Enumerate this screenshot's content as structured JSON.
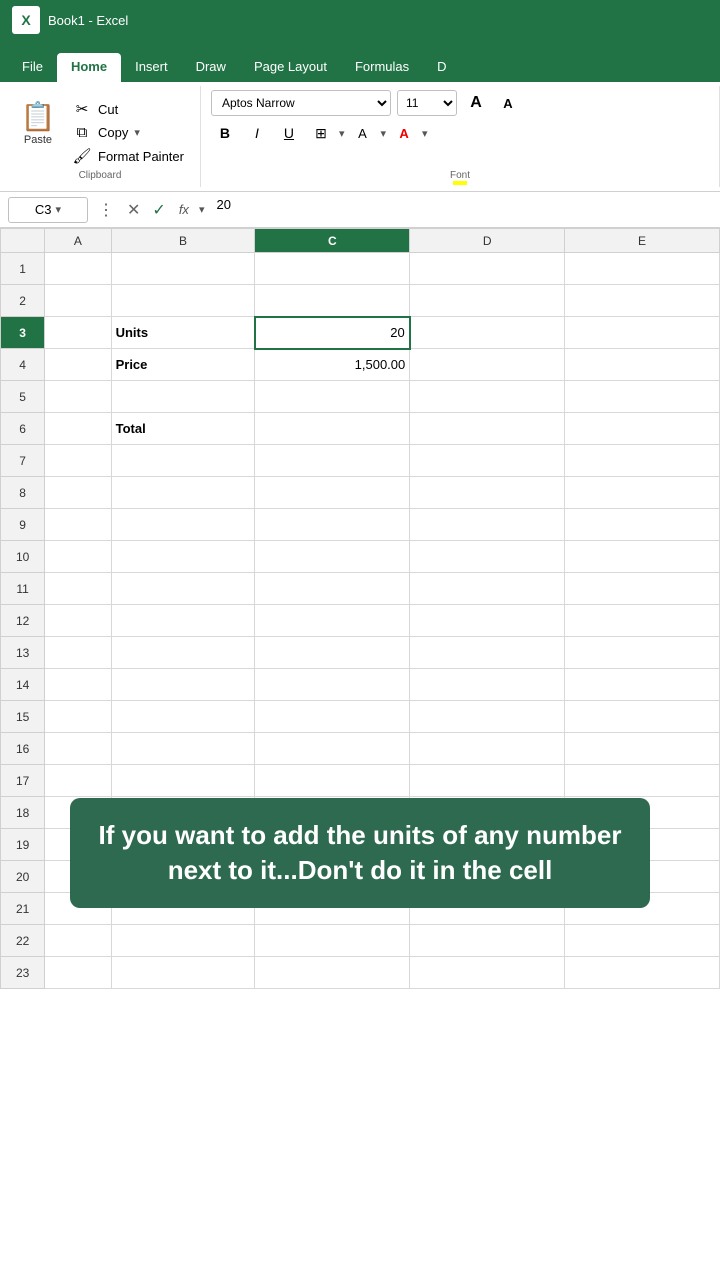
{
  "titlebar": {
    "logo": "X",
    "title": "Book1 - Excel"
  },
  "ribbon": {
    "tabs": [
      "File",
      "Home",
      "Insert",
      "Draw",
      "Page Layout",
      "Formulas",
      "D"
    ],
    "active_tab": "Home",
    "clipboard_group": {
      "label": "Clipboard",
      "paste_label": "Paste",
      "cut_label": "Cut",
      "copy_label": "Copy",
      "format_painter_label": "Format Painter"
    },
    "font_group": {
      "label": "Font",
      "font_name": "Aptos Narrow",
      "font_size": "11",
      "bold": "B",
      "italic": "I",
      "underline": "U"
    }
  },
  "formula_bar": {
    "cell_ref": "C3",
    "formula_value": "20"
  },
  "columns": [
    "A",
    "B",
    "C",
    "D",
    "E"
  ],
  "rows": [
    {
      "num": 1,
      "cells": [
        "",
        "",
        "",
        "",
        ""
      ]
    },
    {
      "num": 2,
      "cells": [
        "",
        "",
        "",
        "",
        ""
      ]
    },
    {
      "num": 3,
      "cells": [
        "",
        "Units",
        "20",
        "",
        ""
      ]
    },
    {
      "num": 4,
      "cells": [
        "",
        "Price",
        "1,500.00",
        "",
        ""
      ]
    },
    {
      "num": 5,
      "cells": [
        "",
        "",
        "",
        "",
        ""
      ]
    },
    {
      "num": 6,
      "cells": [
        "",
        "Total",
        "",
        "",
        ""
      ]
    },
    {
      "num": 7,
      "cells": [
        "",
        "",
        "",
        "",
        ""
      ]
    },
    {
      "num": 8,
      "cells": [
        "",
        "",
        "",
        "",
        ""
      ]
    },
    {
      "num": 9,
      "cells": [
        "",
        "",
        "",
        "",
        ""
      ]
    },
    {
      "num": 10,
      "cells": [
        "",
        "",
        "",
        "",
        ""
      ]
    },
    {
      "num": 11,
      "cells": [
        "",
        "",
        "",
        "",
        ""
      ]
    },
    {
      "num": 12,
      "cells": [
        "",
        "",
        "",
        "",
        ""
      ]
    },
    {
      "num": 13,
      "cells": [
        "",
        "",
        "",
        "",
        ""
      ]
    },
    {
      "num": 14,
      "cells": [
        "",
        "",
        "",
        "",
        ""
      ]
    },
    {
      "num": 15,
      "cells": [
        "",
        "",
        "",
        "",
        ""
      ]
    },
    {
      "num": 16,
      "cells": [
        "",
        "",
        "",
        "",
        ""
      ]
    },
    {
      "num": 17,
      "cells": [
        "",
        "",
        "",
        "",
        ""
      ]
    },
    {
      "num": 18,
      "cells": [
        "",
        "",
        "",
        "",
        ""
      ]
    },
    {
      "num": 19,
      "cells": [
        "",
        "",
        "",
        "",
        ""
      ]
    },
    {
      "num": 20,
      "cells": [
        "",
        "",
        "",
        "",
        ""
      ]
    },
    {
      "num": 21,
      "cells": [
        "",
        "",
        "",
        "",
        ""
      ]
    },
    {
      "num": 22,
      "cells": [
        "",
        "",
        "",
        "",
        ""
      ]
    },
    {
      "num": 23,
      "cells": [
        "",
        "",
        "",
        "",
        ""
      ]
    }
  ],
  "overlay": {
    "text": "If you want to add the units of any number next to it...Don't do it in the cell"
  }
}
